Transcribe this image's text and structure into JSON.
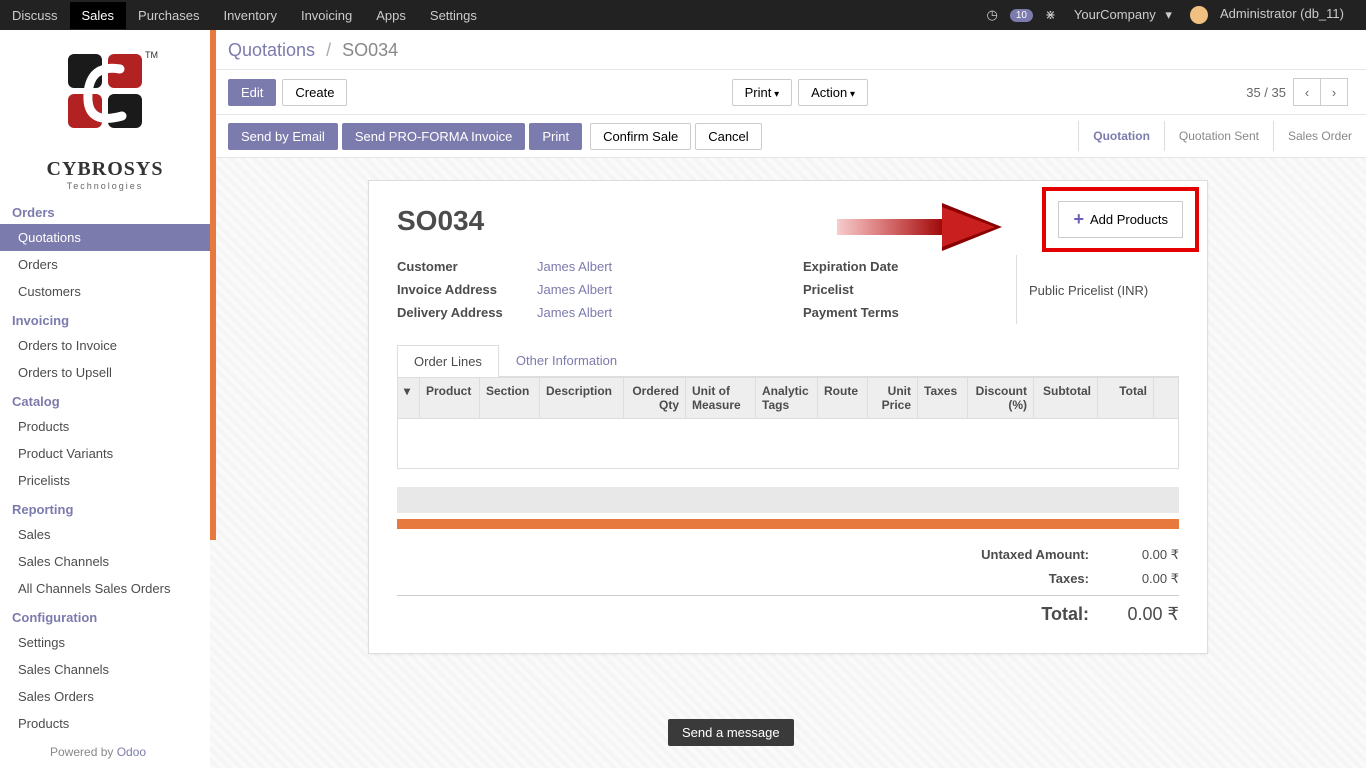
{
  "topnav": {
    "items": [
      "Discuss",
      "Sales",
      "Purchases",
      "Inventory",
      "Invoicing",
      "Apps",
      "Settings"
    ],
    "active": "Sales",
    "msg_count": "10",
    "company": "YourCompany",
    "user": "Administrator (db_11)"
  },
  "sidebar": {
    "logo_title": "CYBROSYS",
    "logo_sub": "Technologies",
    "sections": [
      {
        "title": "Orders",
        "items": [
          "Quotations",
          "Orders",
          "Customers"
        ],
        "active": "Quotations"
      },
      {
        "title": "Invoicing",
        "items": [
          "Orders to Invoice",
          "Orders to Upsell"
        ]
      },
      {
        "title": "Catalog",
        "items": [
          "Products",
          "Product Variants",
          "Pricelists"
        ]
      },
      {
        "title": "Reporting",
        "items": [
          "Sales",
          "Sales Channels",
          "All Channels Sales Orders"
        ]
      },
      {
        "title": "Configuration",
        "items": [
          "Settings",
          "Sales Channels",
          "Sales Orders",
          "Products"
        ]
      }
    ],
    "footer_prefix": "Powered by ",
    "footer_link": "Odoo"
  },
  "breadcrumb": {
    "root": "Quotations",
    "current": "SO034"
  },
  "buttons": {
    "edit": "Edit",
    "create": "Create",
    "print": "Print",
    "action": "Action",
    "send_email": "Send by Email",
    "send_proforma": "Send PRO-FORMA Invoice",
    "print2": "Print",
    "confirm": "Confirm Sale",
    "cancel": "Cancel",
    "add_products": "Add Products"
  },
  "pager": {
    "text": "35 / 35"
  },
  "status": {
    "steps": [
      "Quotation",
      "Quotation Sent",
      "Sales Order"
    ],
    "active": "Quotation"
  },
  "form": {
    "title": "SO034",
    "customer_label": "Customer",
    "customer": "James Albert",
    "invoice_addr_label": "Invoice Address",
    "invoice_addr": "James Albert",
    "delivery_addr_label": "Delivery Address",
    "delivery_addr": "James Albert",
    "expiration_label": "Expiration Date",
    "expiration": "",
    "pricelist_label": "Pricelist",
    "pricelist": "Public Pricelist (INR)",
    "payment_label": "Payment Terms",
    "payment": ""
  },
  "tabs": [
    "Order Lines",
    "Other Information"
  ],
  "table_columns": [
    "",
    "Product",
    "Section",
    "Description",
    "Ordered Qty",
    "Unit of Measure",
    "Analytic Tags",
    "Route",
    "Unit Price",
    "Taxes",
    "Discount (%)",
    "Subtotal",
    "Total"
  ],
  "totals": {
    "untaxed_label": "Untaxed Amount:",
    "untaxed": "0.00 ₹",
    "taxes_label": "Taxes:",
    "taxes": "0.00 ₹",
    "total_label": "Total:",
    "total": "0.00 ₹"
  },
  "tooltip": "Send a message"
}
